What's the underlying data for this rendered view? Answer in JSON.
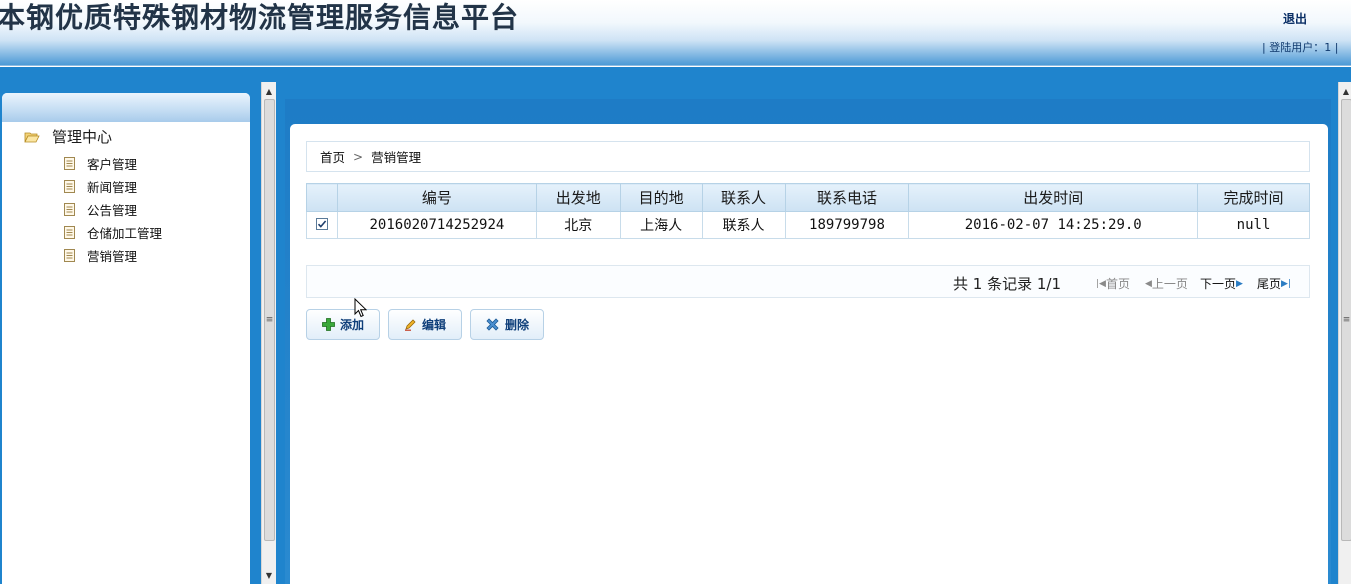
{
  "header": {
    "site_title": "本钢优质特殊钢材物流管理服务信息平台",
    "logout_label": "退出",
    "login_info": "| 登陆用户：1 |"
  },
  "sidebar": {
    "root_label": "管理中心",
    "items": [
      {
        "label": "客户管理"
      },
      {
        "label": "新闻管理"
      },
      {
        "label": "公告管理"
      },
      {
        "label": "仓储加工管理"
      },
      {
        "label": "营销管理"
      }
    ]
  },
  "breadcrumb": {
    "home": "首页",
    "separator": ">",
    "current": "营销管理"
  },
  "table": {
    "columns": [
      "",
      "编号",
      "出发地",
      "目的地",
      "联系人",
      "联系电话",
      "出发时间",
      "完成时间"
    ],
    "rows": [
      {
        "checked": true,
        "id": "2016020714252924",
        "origin": "北京",
        "destination": "上海人",
        "contact": "联系人",
        "phone": "189799798",
        "depart_time": "2016-02-07 14:25:29.0",
        "finish_time": "null"
      }
    ]
  },
  "pager": {
    "summary": "共 1 条记录 1/1",
    "first": "首页",
    "prev": "上一页",
    "next": "下一页",
    "last": "尾页"
  },
  "actions": {
    "add": "添加",
    "edit": "编辑",
    "delete": "删除"
  },
  "icons": [
    "folder-open-icon",
    "document-icon",
    "checkbox-icon",
    "plus-icon",
    "pencil-icon",
    "delete-x-icon",
    "mouse-cursor-icon"
  ],
  "colors": {
    "band_blue": "#1f84cd",
    "title_text": "#223448",
    "button_text": "#0f3f7a"
  }
}
